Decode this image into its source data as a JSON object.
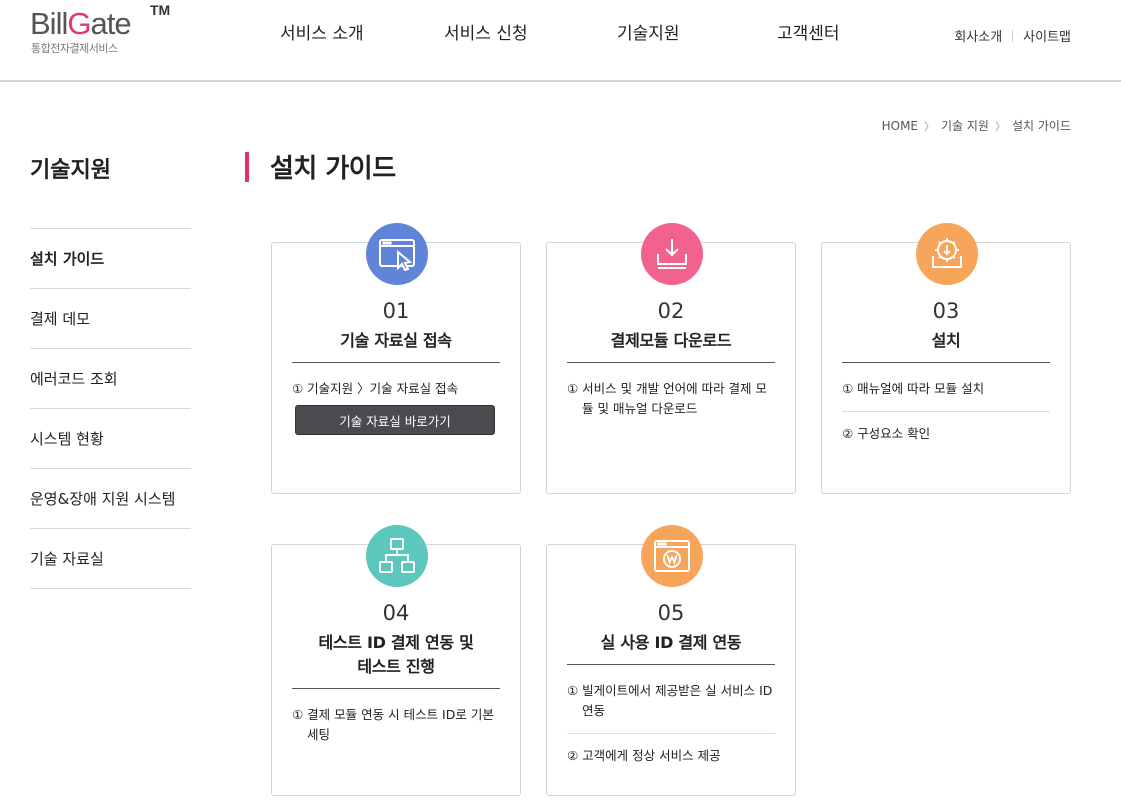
{
  "header": {
    "logo_main_a": "Bill",
    "logo_main_b": "G",
    "logo_main_c": "ate",
    "logo_tm": "TM",
    "logo_sub": "통합전자결제서비스",
    "nav": [
      "서비스 소개",
      "서비스 신청",
      "기술지원",
      "고객센터"
    ],
    "util": [
      "회사소개",
      "사이트맵"
    ]
  },
  "breadcrumb": [
    "HOME",
    "기술 지원",
    "설치 가이드"
  ],
  "breadcrumb_sep": "〉",
  "sidebar": {
    "title": "기술지원",
    "items": [
      "설치 가이드",
      "결제 데모",
      "에러코드 조회",
      "시스템 현황",
      "운영&장애 지원 시스템",
      "기술 자료실"
    ],
    "active_index": 0
  },
  "page_title": "설치 가이드",
  "colors": {
    "accent": "#e0336a",
    "step1": "#5f84d8",
    "step2": "#f2628f",
    "step3": "#f7a55a",
    "step4": "#5cc8bd",
    "step5": "#f7a55a"
  },
  "cards": [
    {
      "num": "01",
      "title_l1": "기술 자료실 접속",
      "title_l2": "",
      "icon": "browser-cursor-icon",
      "steps": [
        "① 기술지원 〉기술 자료실 접속"
      ],
      "button": "기술 자료실 바로가기"
    },
    {
      "num": "02",
      "title_l1": "결제모듈 다운로드",
      "title_l2": "",
      "icon": "download-tray-icon",
      "steps": [
        "① 서비스 및 개발 언어에 따라 결제 모듈 및 매뉴얼 다운로드"
      ]
    },
    {
      "num": "03",
      "title_l1": "설치",
      "title_l2": "",
      "icon": "install-gear-icon",
      "steps": [
        "① 매뉴얼에 따라 모듈 설치",
        "② 구성요소 확인"
      ]
    },
    {
      "num": "04",
      "title_l1": "테스트 ID 결제 연동 및",
      "title_l2": "테스트 진행",
      "icon": "network-diagram-icon",
      "steps": [
        "① 결제 모듈 연동 시 테스트 ID로 기본 세팅"
      ]
    },
    {
      "num": "05",
      "title_l1": "실 사용 ID 결제 연동",
      "title_l2": "",
      "icon": "won-browser-icon",
      "steps": [
        "① 빌게이트에서 제공받은 실 서비스 ID 연동",
        "② 고객에게 정상 서비스 제공"
      ]
    }
  ]
}
